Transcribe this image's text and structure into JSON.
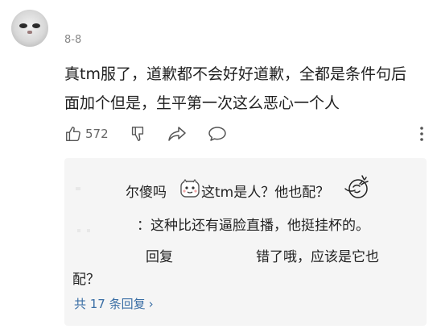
{
  "comment": {
    "date": "8-8",
    "text_line1": "真tm服了，道歉都不会好好道歉，全都是条件句后",
    "text_line2": "面加个但是，生平第一次这么恶心一个人",
    "likes": "572"
  },
  "icons": {
    "like": "thumbs-up-icon",
    "dislike": "thumbs-down-icon",
    "share": "share-icon",
    "comment": "comment-icon",
    "more": "more-vertical-icon",
    "emoji1": "face-emoji-icon",
    "emoji2": "facepalm-emoji-icon"
  },
  "replies": {
    "line1_a": "尔傻吗",
    "line1_b": "这tm是人？他也配？",
    "line2": "：这种比还有逼脸直播，他挺挂杯的。",
    "line3_a": "回复",
    "line3_b": "错了哦，应该是它也",
    "line3_c": "配？",
    "more_label": "共 17 条回复",
    "more_chevron": "›"
  },
  "colors": {
    "link": "#3a6ea5",
    "reply_bg": "#f5f5f5",
    "muted": "#888888"
  }
}
